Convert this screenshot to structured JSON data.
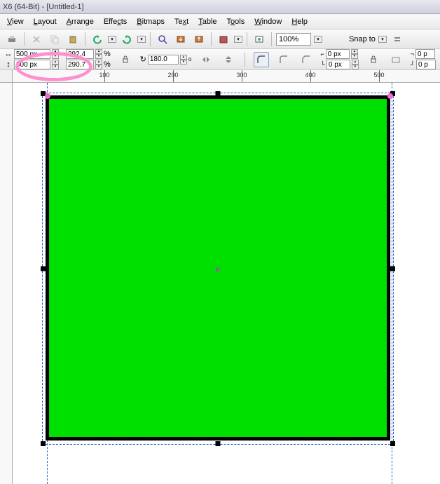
{
  "title": "X6 (64-Bit) - [Untitled-1]",
  "menu": {
    "view": "View",
    "layout": "Layout",
    "arrange": "Arrange",
    "effects": "Effects",
    "bitmaps": "Bitmaps",
    "text": "Text",
    "table": "Table",
    "tools": "Tools",
    "window": "Window",
    "help": "Help"
  },
  "toolbar": {
    "zoom": "100%",
    "snap": "Snap to"
  },
  "props": {
    "width": "500 px",
    "height": "500 px",
    "scale_x": "292.4",
    "scale_y": "290.7",
    "scale_unit": "%",
    "rotation": "180.0",
    "rotation_unit": "o",
    "outline1": "0 px",
    "outline2": "0 px",
    "corner1": "0 p",
    "corner2": "0 p"
  },
  "ruler": {
    "ticks": [
      "100",
      "200",
      "300",
      "400",
      "500"
    ]
  },
  "shape": {
    "fill": "#00e000",
    "stroke": "#000000",
    "stroke_width": 5
  },
  "chart_data": {
    "type": "other",
    "note": "not a chart"
  }
}
